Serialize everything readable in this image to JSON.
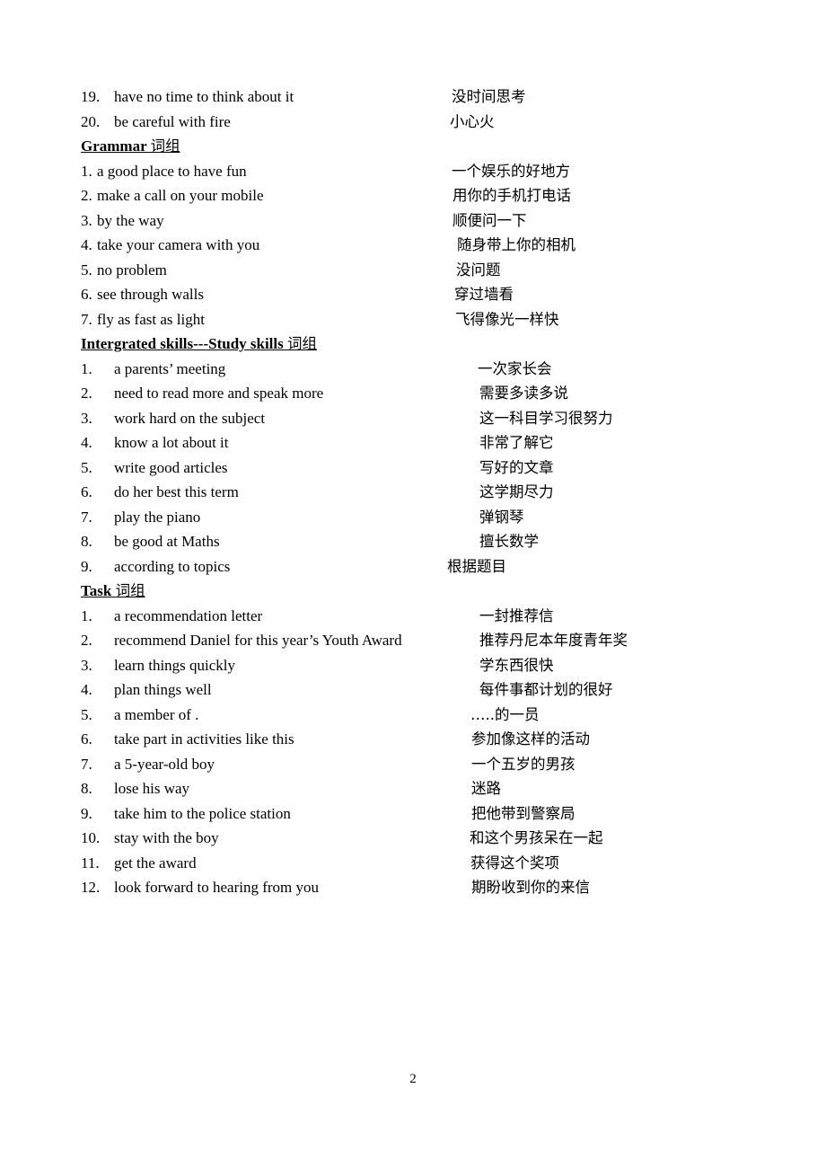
{
  "page_number": "2",
  "continued": [
    {
      "num": "19.",
      "en": "have no time to think about it",
      "zh": "没时间思考"
    },
    {
      "num": "20.",
      "en": "be careful with fire",
      "zh": "小心火"
    }
  ],
  "grammar": {
    "title_en": "Grammar ",
    "title_zh": "词组",
    "items": [
      {
        "num": "1.",
        "en": "a good place to have fun",
        "zh": "一个娱乐的好地方"
      },
      {
        "num": "2.",
        "en": "make a call on your mobile",
        "zh": "用你的手机打电话"
      },
      {
        "num": "3.",
        "en": "by the way",
        "zh": "顺便问一下"
      },
      {
        "num": "4.",
        "en": "take your camera with you",
        "zh": "随身带上你的相机"
      },
      {
        "num": "5.",
        "en": "no problem",
        "zh": "没问题"
      },
      {
        "num": "6.",
        "en": "see through walls",
        "zh": "穿过墙看"
      },
      {
        "num": "7.",
        "en": "fly as fast as light",
        "zh": "飞得像光一样快"
      }
    ]
  },
  "skills": {
    "title_en": "Intergrated skills---Study skills ",
    "title_zh": "词组",
    "items": [
      {
        "num": "1.",
        "en": "a parents’ meeting",
        "zh": "一次家长会"
      },
      {
        "num": "2.",
        "en": "need to read more and speak more",
        "zh": "需要多读多说"
      },
      {
        "num": "3.",
        "en": "work hard on the subject",
        "zh": "这一科目学习很努力"
      },
      {
        "num": "4.",
        "en": "know a lot about it",
        "zh": "非常了解它"
      },
      {
        "num": "5.",
        "en": "write good articles",
        "zh": "写好的文章"
      },
      {
        "num": "6.",
        "en": "do her best this term",
        "zh": "这学期尽力"
      },
      {
        "num": "7.",
        "en": "play the piano",
        "zh": "弹钢琴"
      },
      {
        "num": "8.",
        "en": "be good at Maths",
        "zh": "擅长数学"
      },
      {
        "num": "9.",
        "en": "according to topics",
        "zh": "根据题目"
      }
    ]
  },
  "task": {
    "title_en": "Task ",
    "title_zh": "词组",
    "items": [
      {
        "num": "1.",
        "en": "a recommendation letter",
        "zh": "一封推荐信"
      },
      {
        "num": "2.",
        "en": "recommend Daniel for this year’s Youth Award",
        "zh": "推荐丹尼本年度青年奖"
      },
      {
        "num": "3.",
        "en": "learn things quickly",
        "zh": "学东西很快"
      },
      {
        "num": "4.",
        "en": "plan things well",
        "zh": "每件事都计划的很好"
      },
      {
        "num": "5.",
        "en": "a member of .",
        "zh": "…..的一员"
      },
      {
        "num": "6.",
        "en": "take part in activities like this",
        "zh": "参加像这样的活动"
      },
      {
        "num": "7.",
        "en": "a 5-year-old boy",
        "zh": "一个五岁的男孩"
      },
      {
        "num": "8.",
        "en": "lose his way",
        "zh": "迷路"
      },
      {
        "num": "9.",
        "en": "take him to the police station",
        "zh": "把他带到警察局"
      },
      {
        "num": "10.",
        "en": "stay with the boy",
        "zh": "和这个男孩呆在一起"
      },
      {
        "num": "11.",
        "en": "get the award",
        "zh": "获得这个奖项"
      },
      {
        "num": "12.",
        "en": "look forward to hearing from you",
        "zh": "期盼收到你的来信"
      }
    ]
  }
}
